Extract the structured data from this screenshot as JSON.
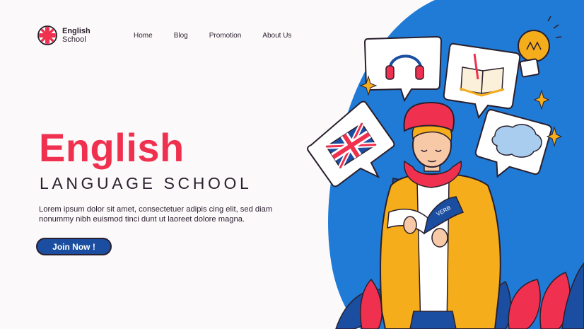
{
  "brand": {
    "line1": "English",
    "line2": "School",
    "icon": "union-jack-icon"
  },
  "nav": [
    "Home",
    "Blog",
    "Promotion",
    "About Us"
  ],
  "hero": {
    "title": "English",
    "subtitle": "LANGUAGE SCHOOL",
    "body": "Lorem ipsum dolor sit amet, consectetuer adipis cing elit, sed diam nonummy nibh euismod tinci dunt ut laoreet dolore magna.",
    "cta": "Join Now !"
  },
  "illustration": {
    "book_label": "VERB",
    "icons": [
      "headphones-icon",
      "open-book-icon",
      "lightbulb-icon",
      "union-jack-flag-icon",
      "speech-cloud-icon",
      "sparkle-icon"
    ]
  },
  "colors": {
    "accent": "#f0304f",
    "brand_blue": "#1b4ea0",
    "illustration_blue": "#1f7bd6",
    "text": "#2a1f2d",
    "jacket": "#f5ad1b"
  }
}
